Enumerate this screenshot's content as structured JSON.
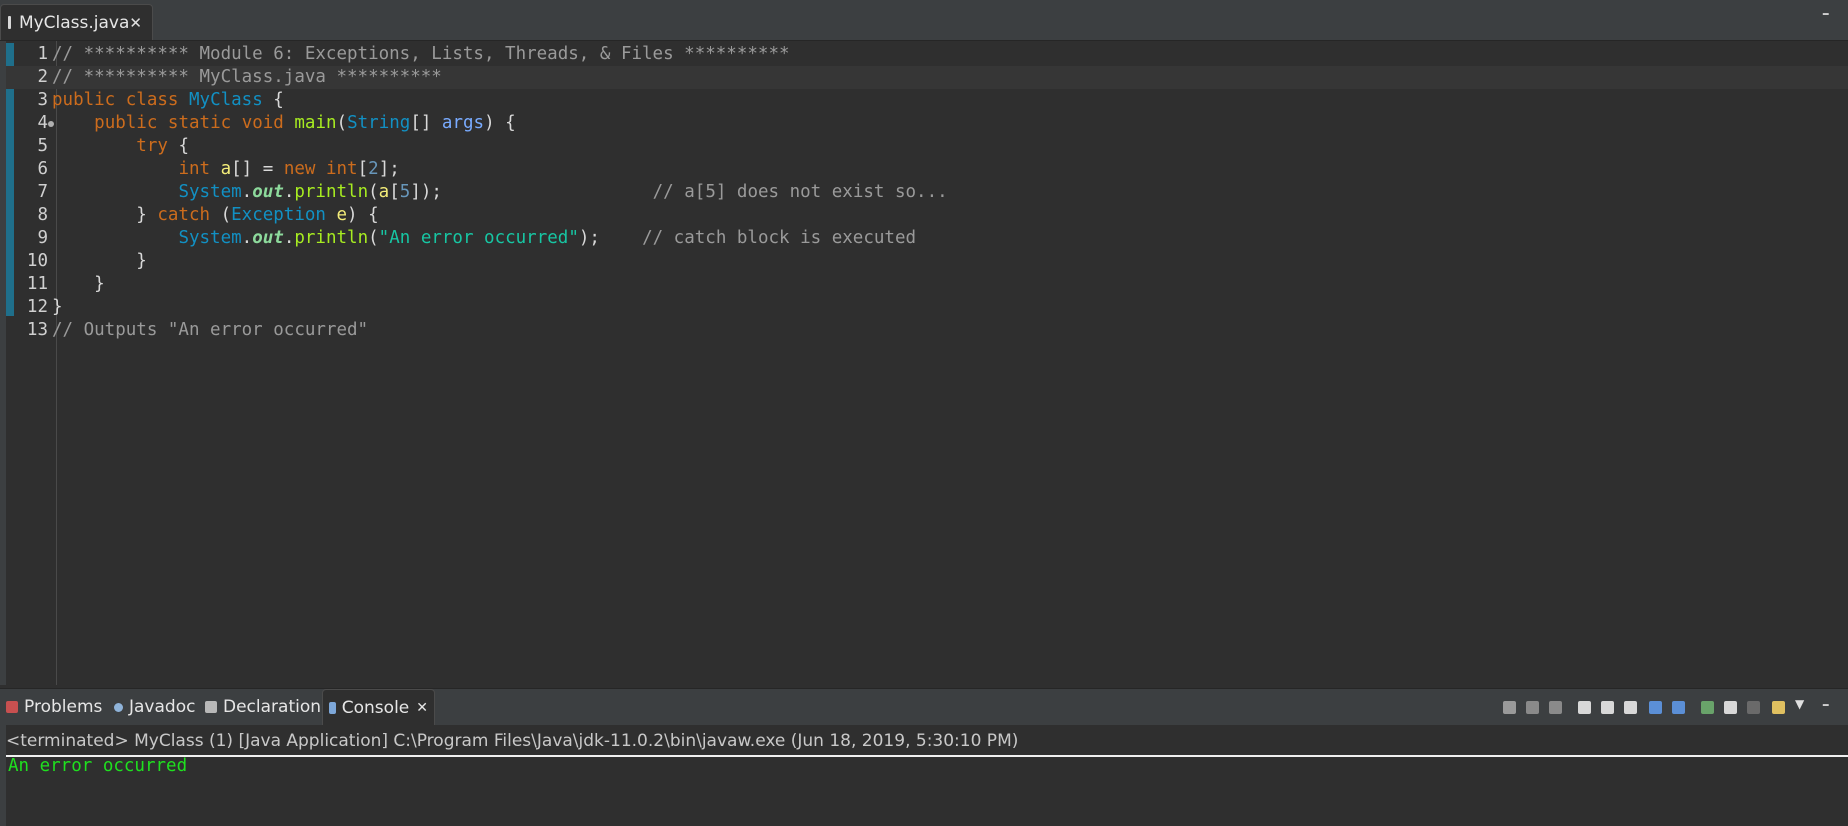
{
  "editor": {
    "tab_label": "MyClass.java",
    "close_glyph": "✕",
    "lines": [
      {
        "num": "1",
        "tokens": [
          [
            "cm",
            "// ********** Module 6: Exceptions, Lists, Threads, & Files **********"
          ]
        ]
      },
      {
        "num": "2",
        "tokens": [
          [
            "cm",
            "// ********** MyClass.java **********"
          ]
        ]
      },
      {
        "num": "3",
        "tokens": [
          [
            "kw",
            "public"
          ],
          [
            "pl",
            " "
          ],
          [
            "kw",
            "class"
          ],
          [
            "pl",
            " "
          ],
          [
            "ty",
            "MyClass"
          ],
          [
            "pl",
            " {"
          ]
        ]
      },
      {
        "num": "4",
        "tokens": [
          [
            "pl",
            "    "
          ],
          [
            "kw",
            "public"
          ],
          [
            "pl",
            " "
          ],
          [
            "kw",
            "static"
          ],
          [
            "pl",
            " "
          ],
          [
            "kw",
            "void"
          ],
          [
            "pl",
            " "
          ],
          [
            "mt",
            "main"
          ],
          [
            "pl",
            "("
          ],
          [
            "ty",
            "String"
          ],
          [
            "pl",
            "[] "
          ],
          [
            "vr",
            "args"
          ],
          [
            "pl",
            ") {"
          ]
        ]
      },
      {
        "num": "5",
        "tokens": [
          [
            "pl",
            "        "
          ],
          [
            "kw",
            "try"
          ],
          [
            "pl",
            " {"
          ]
        ]
      },
      {
        "num": "6",
        "tokens": [
          [
            "pl",
            "            "
          ],
          [
            "kw",
            "int"
          ],
          [
            "pl",
            " "
          ],
          [
            "lv",
            "a"
          ],
          [
            "pl",
            "[] = "
          ],
          [
            "kw",
            "new"
          ],
          [
            "pl",
            " "
          ],
          [
            "kw",
            "int"
          ],
          [
            "pl",
            "["
          ],
          [
            "nm",
            "2"
          ],
          [
            "pl",
            "];"
          ]
        ]
      },
      {
        "num": "7",
        "tokens": [
          [
            "pl",
            "            "
          ],
          [
            "ty",
            "System"
          ],
          [
            "pl",
            "."
          ],
          [
            "fd",
            "out"
          ],
          [
            "pl",
            "."
          ],
          [
            "mt",
            "println"
          ],
          [
            "pl",
            "("
          ],
          [
            "lv",
            "a"
          ],
          [
            "pl",
            "["
          ],
          [
            "nm",
            "5"
          ],
          [
            "pl",
            "]);                    "
          ],
          [
            "cm",
            "// a[5] does not exist so..."
          ]
        ]
      },
      {
        "num": "8",
        "tokens": [
          [
            "pl",
            "        } "
          ],
          [
            "kw",
            "catch"
          ],
          [
            "pl",
            " ("
          ],
          [
            "ty",
            "Exception"
          ],
          [
            "pl",
            " "
          ],
          [
            "lv",
            "e"
          ],
          [
            "pl",
            ") {"
          ]
        ]
      },
      {
        "num": "9",
        "tokens": [
          [
            "pl",
            "            "
          ],
          [
            "ty",
            "System"
          ],
          [
            "pl",
            "."
          ],
          [
            "fd",
            "out"
          ],
          [
            "pl",
            "."
          ],
          [
            "mt",
            "println"
          ],
          [
            "pl",
            "("
          ],
          [
            "st",
            "\"An error occurred\""
          ],
          [
            "pl",
            ");    "
          ],
          [
            "cm",
            "// catch block is executed"
          ]
        ]
      },
      {
        "num": "10",
        "tokens": [
          [
            "pl",
            "        }"
          ]
        ]
      },
      {
        "num": "11",
        "tokens": [
          [
            "pl",
            "    }"
          ]
        ]
      },
      {
        "num": "12",
        "tokens": [
          [
            "pl",
            "}"
          ]
        ]
      },
      {
        "num": "13",
        "tokens": [
          [
            "cm",
            "// Outputs \"An error occurred\""
          ]
        ]
      }
    ]
  },
  "panel": {
    "tabs": [
      {
        "label": "Problems",
        "icon": "problems-icon"
      },
      {
        "label": "Javadoc",
        "icon": "javadoc-icon"
      },
      {
        "label": "Declaration",
        "icon": "declaration-icon"
      },
      {
        "label": "Console",
        "icon": "console-icon"
      }
    ],
    "console_header": "<terminated> MyClass (1) [Java Application] C:\\Program Files\\Java\\jdk-11.0.2\\bin\\javaw.exe (Jun 18, 2019, 5:30:10 PM)",
    "console_output": "An error occurred"
  },
  "colors": {
    "comment": "#9a9a9a",
    "keyword": "#cc6c1d",
    "type": "#1290c3",
    "method": "#a7ec21",
    "string": "#17c6a3",
    "console_output": "#1fe01f"
  }
}
